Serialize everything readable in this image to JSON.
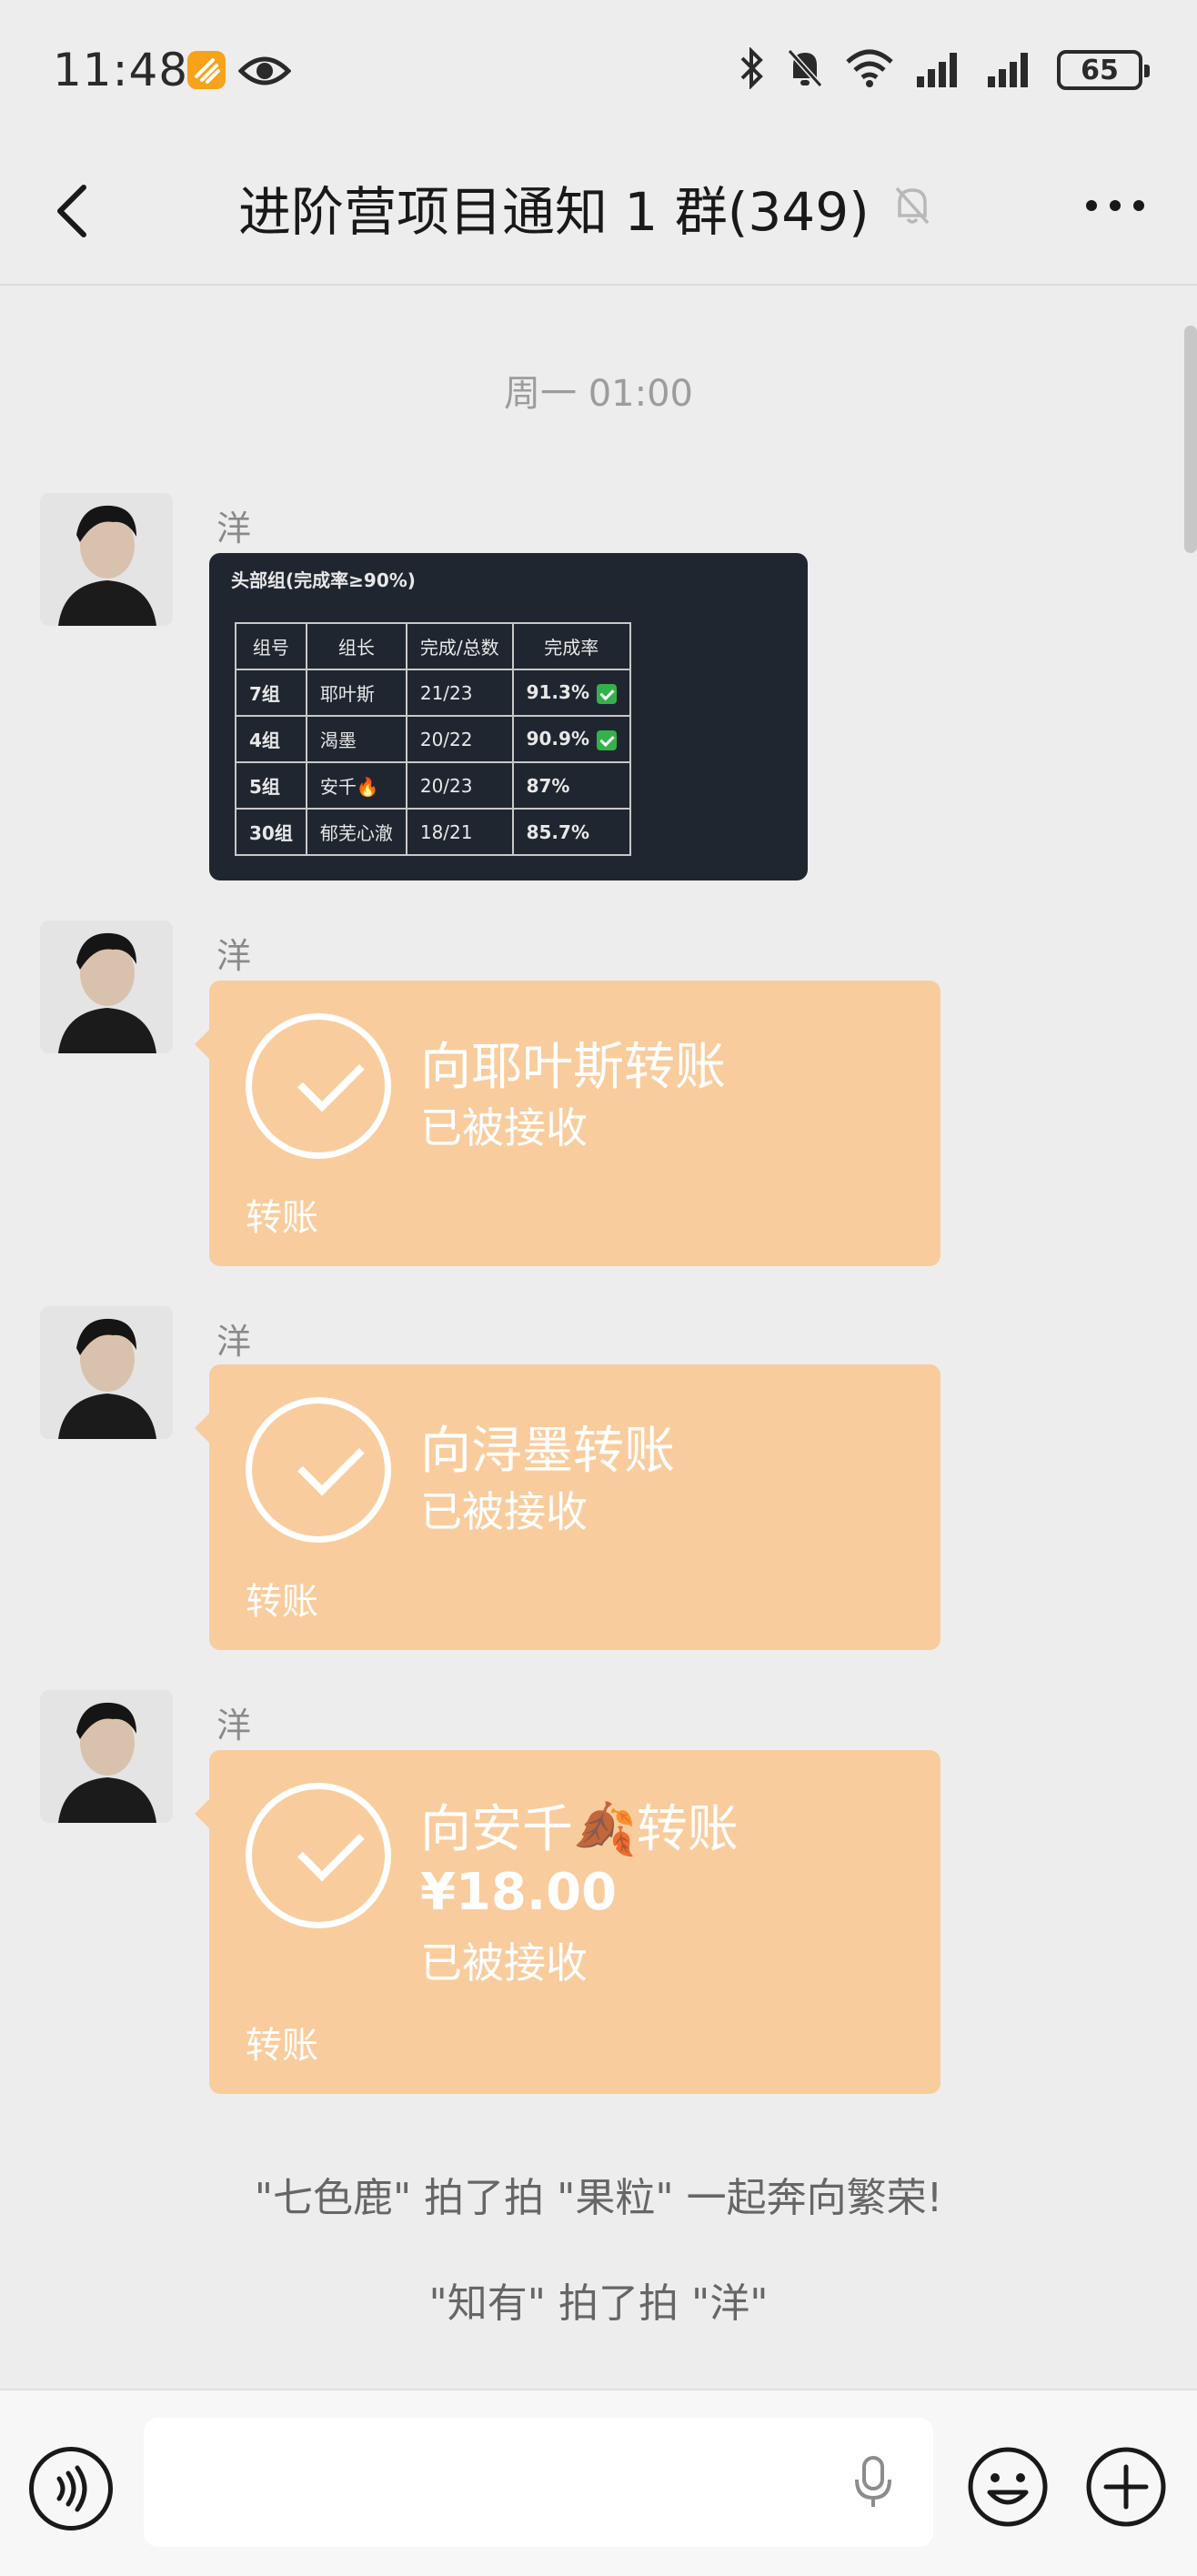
{
  "status_bar": {
    "time": "11:48",
    "battery": "65",
    "icons": [
      "app-notification-icon",
      "eye-icon",
      "bluetooth-icon",
      "bell-muted-icon",
      "wifi-icon",
      "signal-icon",
      "signal-icon",
      "battery-icon"
    ]
  },
  "nav": {
    "title": "进阶营项目通知 1 群(349)",
    "back_icon": "chevron-left-icon",
    "mute_icon": "bell-muted-icon",
    "more_icon": "more-dots-icon"
  },
  "timestamp": "周一 01:00",
  "messages": [
    {
      "sender": "洋",
      "type": "image",
      "image": {
        "title": "头部组(完成率≥90%)",
        "headers": [
          "组号",
          "组长",
          "完成/总数",
          "完成率"
        ],
        "rows": [
          [
            "7组",
            "耶叶斯",
            "21/23",
            "91.3%"
          ],
          [
            "4组",
            "渴墨",
            "20/22",
            "90.9%"
          ],
          [
            "5组",
            "安千🔥",
            "20/23",
            "87%"
          ],
          [
            "30组",
            "郁芜心澈",
            "18/21",
            "85.7%"
          ]
        ]
      }
    },
    {
      "sender": "洋",
      "type": "transfer",
      "title": "向耶叶斯转账",
      "status": "已被接收",
      "label": "转账"
    },
    {
      "sender": "洋",
      "type": "transfer",
      "title": "向浔墨转账",
      "status": "已被接收",
      "label": "转账"
    },
    {
      "sender": "洋",
      "type": "transfer",
      "title": "向安千🍂转账",
      "amount": "¥18.00",
      "status": "已被接收",
      "label": "转账"
    }
  ],
  "system_notes": [
    "\"七色鹿\" 拍了拍 \"果粒\" 一起奔向繁荣!",
    "\"知有\" 拍了拍 \"洋\""
  ],
  "input_bar": {
    "voice_icon": "voice-mode-icon",
    "mic_icon": "microphone-icon",
    "emoji_icon": "emoji-icon",
    "plus_icon": "plus-circle-icon"
  },
  "colors": {
    "background": "#ededed",
    "transfer_bubble": "#f9cc9d",
    "image_card": "#1f2630"
  }
}
